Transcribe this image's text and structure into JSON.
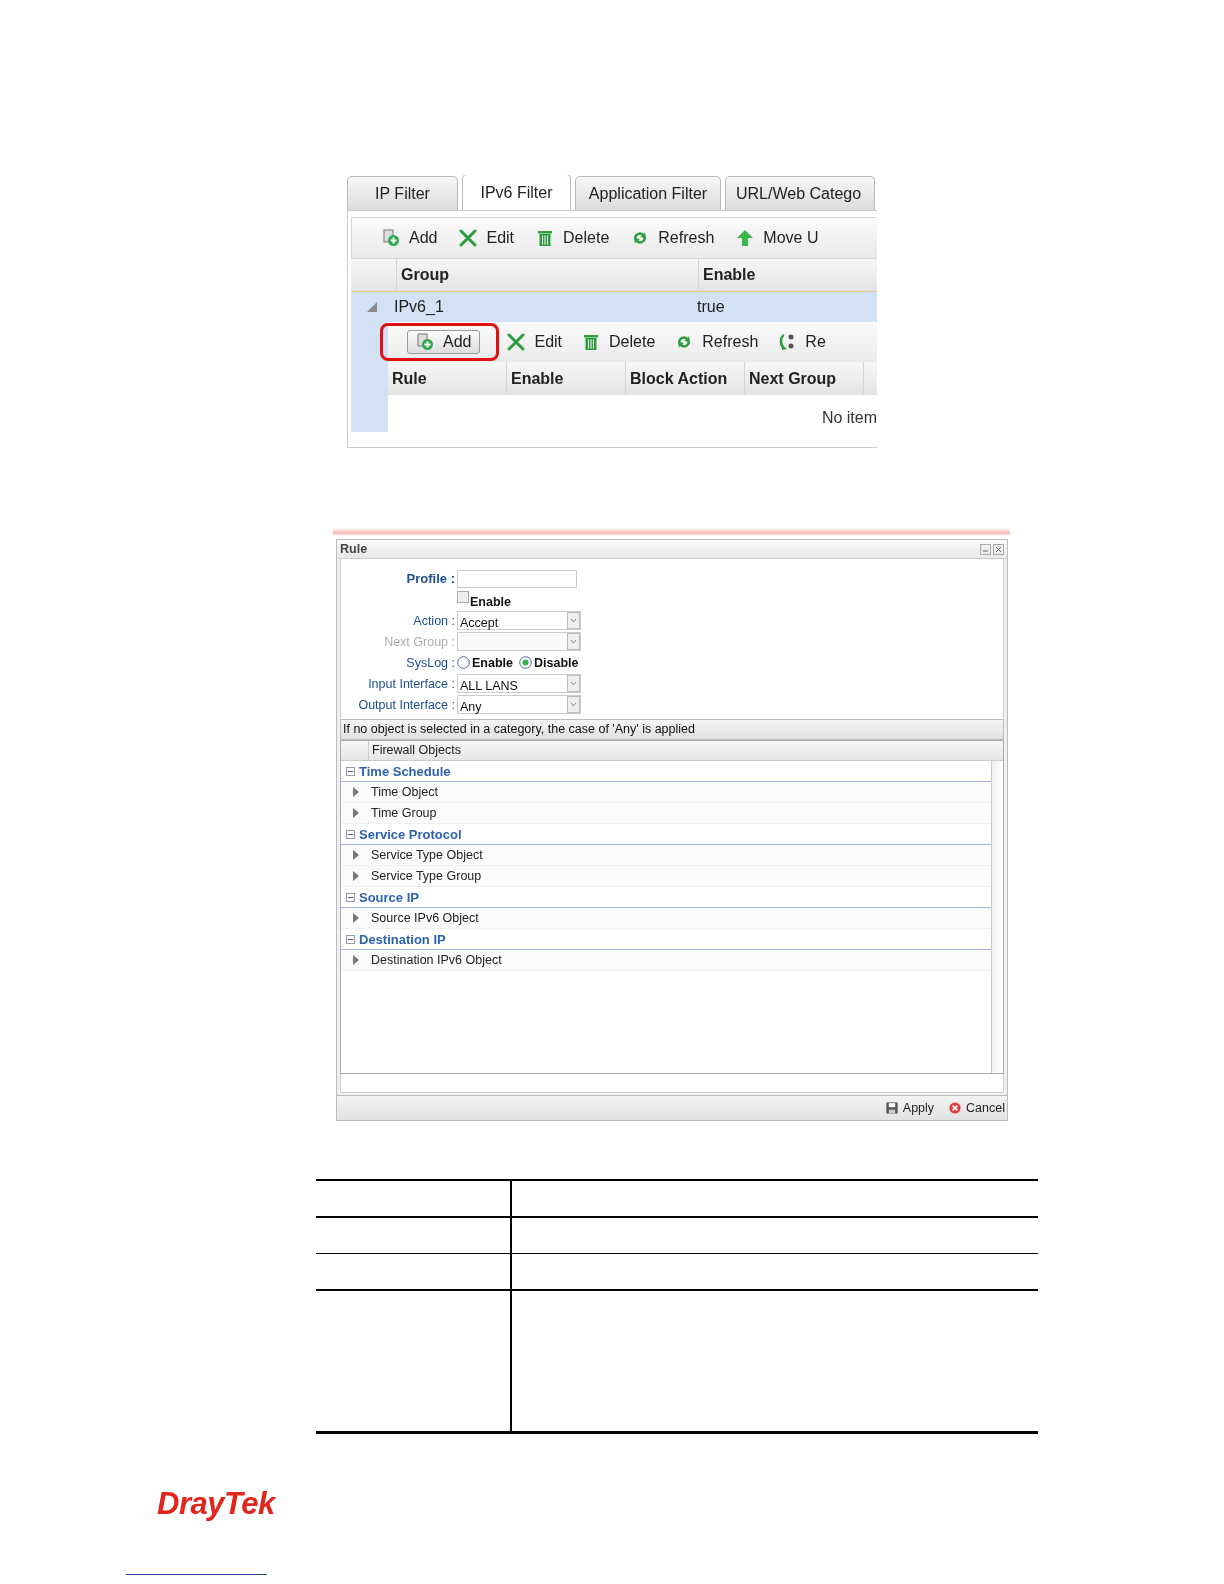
{
  "tabs": [
    {
      "label": "IP Filter",
      "selected": false
    },
    {
      "label": "IPv6 Filter",
      "selected": true
    },
    {
      "label": "Application Filter",
      "selected": false
    },
    {
      "label": "URL/Web Catego",
      "selected": false
    }
  ],
  "toolbar": [
    {
      "label": "Add"
    },
    {
      "label": "Edit"
    },
    {
      "label": "Delete"
    },
    {
      "label": "Refresh"
    },
    {
      "label": "Move U"
    }
  ],
  "group_table": {
    "columns": [
      "Group",
      "Enable"
    ],
    "rows": [
      {
        "group": "IPv6_1",
        "enable": "true",
        "expanded": true,
        "selected": true
      }
    ]
  },
  "rule_toolbar": [
    {
      "label": "Add",
      "highlighted": true
    },
    {
      "label": "Edit",
      "highlighted": false
    },
    {
      "label": "Delete",
      "highlighted": false
    },
    {
      "label": "Refresh",
      "highlighted": false
    },
    {
      "label": "Re",
      "highlighted": false
    }
  ],
  "rule_table": {
    "columns": [
      "Rule",
      "Enable",
      "Block Action",
      "Next Group"
    ],
    "empty_text": "No item"
  },
  "dialog": {
    "title": "Rule",
    "fields": [
      {
        "kind": "text",
        "label": "Profile :",
        "strong": true,
        "disabled": false
      },
      {
        "kind": "checkbox",
        "label": "Enable",
        "checked": false
      },
      {
        "kind": "select",
        "label": "Action :",
        "value": "Accept",
        "disabled": false
      },
      {
        "kind": "select",
        "label": "Next Group :",
        "disabled": true
      },
      {
        "kind": "radio",
        "label": "SysLog :",
        "options": [
          {
            "label": "Enable",
            "selected": false
          },
          {
            "label": "Disable",
            "selected": true
          }
        ]
      },
      {
        "kind": "select",
        "label": "Input Interface :",
        "value": "ALL LANS",
        "disabled": false
      },
      {
        "kind": "select",
        "label": "Output Interface :",
        "value": "Any",
        "disabled": false
      }
    ],
    "note": "If no object is selected in a category, the case of 'Any' is applied",
    "tree_header": "Firewall Objects",
    "tree": [
      {
        "label": "Time Schedule",
        "expanded": true,
        "children": [
          {
            "label": "Time Object"
          },
          {
            "label": "Time Group"
          }
        ]
      },
      {
        "label": "Service Protocol",
        "expanded": true,
        "children": [
          {
            "label": "Service Type Object"
          },
          {
            "label": "Service Type Group"
          }
        ]
      },
      {
        "label": "Source IP",
        "expanded": true,
        "children": [
          {
            "label": "Source IPv6 Object"
          }
        ]
      },
      {
        "label": "Destination IP",
        "expanded": true,
        "children": [
          {
            "label": "Destination IPv6 Object"
          }
        ]
      }
    ],
    "buttons": [
      {
        "label": "Apply"
      },
      {
        "label": "Cancel"
      }
    ]
  },
  "brand": "DrayTek"
}
